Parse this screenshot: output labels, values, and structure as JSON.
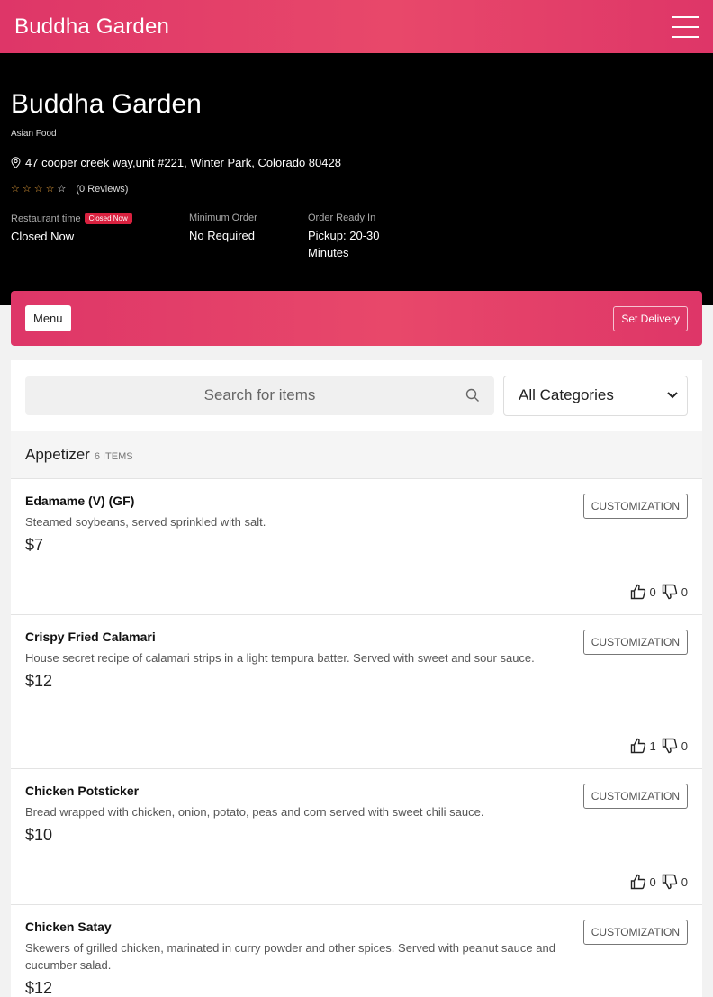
{
  "header": {
    "brand": "Buddha Garden",
    "menu_icon": "hamburger-icon"
  },
  "restaurant": {
    "name": "Buddha Garden",
    "cuisine": "Asian Food",
    "address": "47 cooper creek way,unit #221, Winter Park, Colorado 80428",
    "rating_stars": 0,
    "reviews_text": "(0 Reviews)",
    "info": [
      {
        "label": "Restaurant time",
        "badge": "Closed Now",
        "value": "Closed Now"
      },
      {
        "label": "Minimum Order",
        "value": "No Required"
      },
      {
        "label": "Order Ready In",
        "value": "Pickup: 20-30 Minutes"
      }
    ]
  },
  "menu_bar": {
    "menu_label": "Menu",
    "delivery_label": "Set Delivery"
  },
  "search": {
    "placeholder": "Search for items",
    "category_selected": "All Categories"
  },
  "category": {
    "title": "Appetizer",
    "count": "6 ITEMS"
  },
  "items": [
    {
      "name": "Edamame (V) (GF)",
      "description": "Steamed soybeans, served sprinkled with salt.",
      "price": "$7",
      "likes": "0",
      "dislikes": "0",
      "customization": "CUSTOMIZATION"
    },
    {
      "name": "Crispy Fried Calamari",
      "description": "House secret recipe of calamari strips in a light tempura batter. Served with sweet and sour sauce.",
      "price": "$12",
      "likes": "1",
      "dislikes": "0",
      "customization": "CUSTOMIZATION"
    },
    {
      "name": "Chicken Potsticker",
      "description": "Bread wrapped with chicken, onion, potato, peas and corn served with sweet chili sauce.",
      "price": "$10",
      "likes": "0",
      "dislikes": "0",
      "customization": "CUSTOMIZATION"
    },
    {
      "name": "Chicken Satay",
      "description": "Skewers of grilled chicken, marinated in curry powder and other spices. Served with peanut sauce and cucumber salad.",
      "price": "$12",
      "likes": "",
      "dislikes": "",
      "customization": "CUSTOMIZATION"
    }
  ],
  "colors": {
    "brand_gradient": "#de3668",
    "badge": "#d9213f",
    "star": "#f0a53c"
  }
}
